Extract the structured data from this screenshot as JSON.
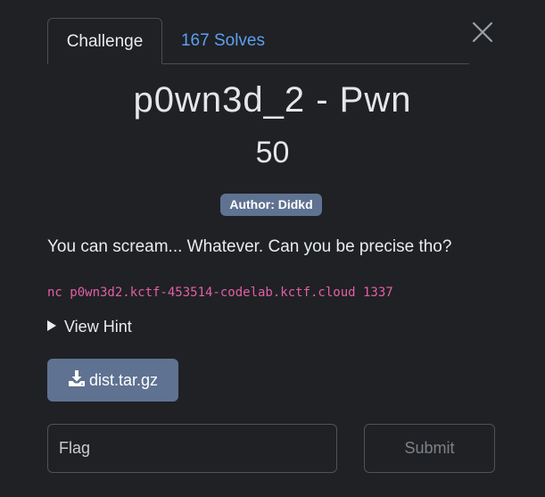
{
  "tabs": [
    {
      "label": "Challenge",
      "active": true
    },
    {
      "label": "167 Solves",
      "active": false
    }
  ],
  "challenge": {
    "title": "p0wn3d_2 - Pwn",
    "points": "50",
    "author_badge": "Author: Didkd",
    "description": "You can scream... Whatever. Can you be precise tho?",
    "connection": "nc p0wn3d2.kctf-453514-codelab.kctf.cloud 1337"
  },
  "hint": {
    "label": "View Hint"
  },
  "download": {
    "label": "dist.tar.gz",
    "icon": "download-icon"
  },
  "flag": {
    "placeholder": "Flag",
    "value": ""
  },
  "submit": {
    "label": "Submit"
  },
  "close": {
    "icon": "close-icon"
  },
  "colors": {
    "background": "#1f2124",
    "accent_link": "#5e9ff0",
    "badge_bg": "#5f7291",
    "code_text": "#e45ea8"
  }
}
